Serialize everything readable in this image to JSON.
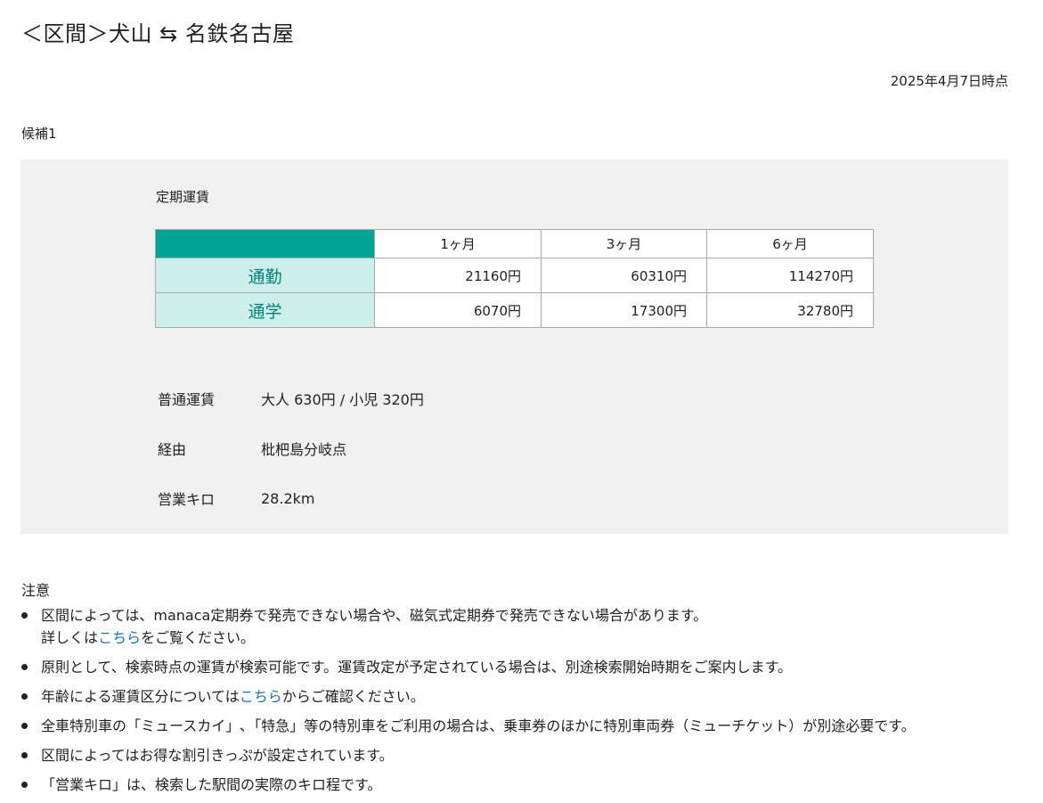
{
  "header": {
    "title": "＜区間＞犬山 ⇆ 名鉄名古屋",
    "as_of": "2025年4月7日時点"
  },
  "candidate": {
    "label": "候補1",
    "commuter_pass": {
      "heading": "定期運賃",
      "columns": [
        "1ヶ月",
        "3ヶ月",
        "6ヶ月"
      ],
      "rows": [
        {
          "label": "通勤",
          "values": [
            "21160円",
            "60310円",
            "114270円"
          ]
        },
        {
          "label": "通学",
          "values": [
            "6070円",
            "17300円",
            "32780円"
          ]
        }
      ]
    },
    "info": [
      {
        "label": "普通運賃",
        "value": "大人 630円 / 小児 320円"
      },
      {
        "label": "経由",
        "value": "枇杷島分岐点"
      },
      {
        "label": "営業キロ",
        "value": "28.2km"
      }
    ]
  },
  "notes": {
    "title": "注意",
    "items": [
      {
        "line1": "区間によっては、manaca定期券で発売できない場合や、磁気式定期券で発売できない場合があります。",
        "line2_before": "詳しくは",
        "line2_link": "こちら",
        "line2_after": "をご覧ください。"
      },
      {
        "text": "原則として、検索時点の運賃が検索可能です。運賃改定が予定されている場合は、別途検索開始時期をご案内します。"
      },
      {
        "before": "年齢による運賃区分については",
        "link": "こちら",
        "after": "からご確認ください。"
      },
      {
        "text": "全車特別車の「ミュースカイ」､「特急」等の特別車をご利用の場合は、乗車券のほかに特別車両券（ミューチケット）が別途必要です。"
      },
      {
        "text": "区間によってはお得な割引きっぷが設定されています。"
      },
      {
        "text": "「営業キロ」は、検索した駅間の実際のキロ程です。"
      }
    ]
  },
  "colors": {
    "table_corner": "#00a496",
    "row_header_bg": "#cdefec",
    "row_header_text": "#00837a",
    "panel_bg": "#f0f0f0",
    "link": "#1a73c8"
  }
}
